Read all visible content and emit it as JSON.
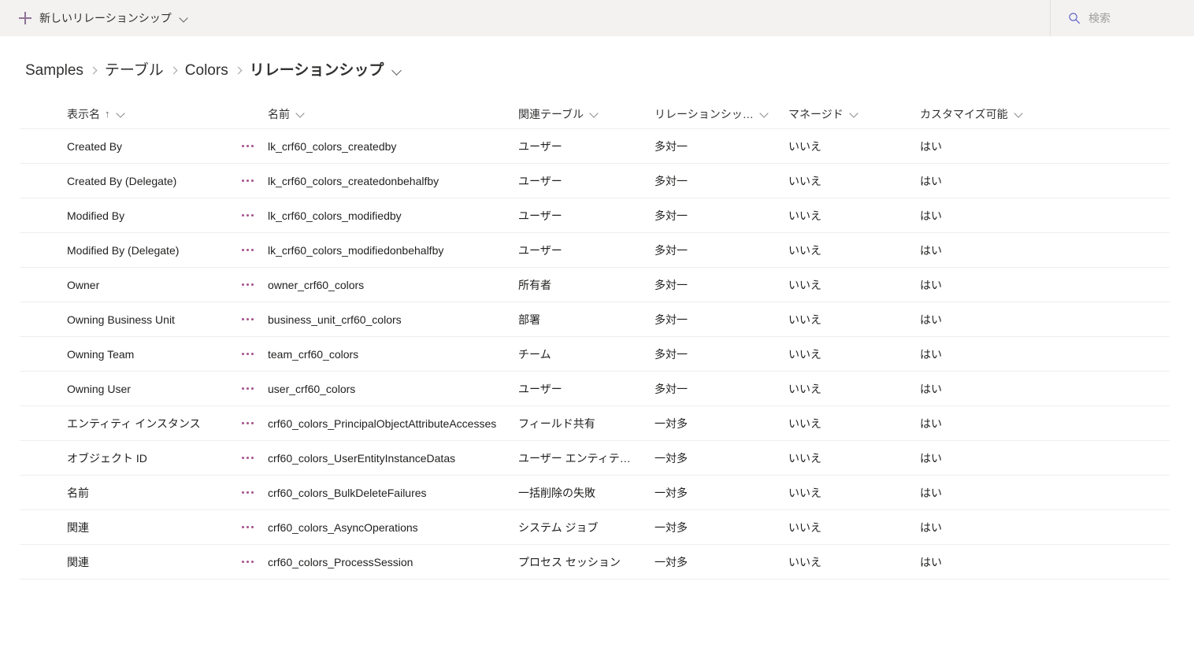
{
  "commandbar": {
    "new_relationship_label": "新しいリレーションシップ",
    "plus_icon": "plus-icon",
    "chevron_icon": "chevron-down-icon",
    "accent_color": "#8f7296"
  },
  "search": {
    "placeholder": "検索",
    "value": "",
    "icon": "search-icon",
    "icon_color": "#5b5fc7"
  },
  "breadcrumb": {
    "items": [
      {
        "label": "Samples",
        "current": false
      },
      {
        "label": "テーブル",
        "current": false
      },
      {
        "label": "Colors",
        "current": false
      },
      {
        "label": "リレーションシップ",
        "current": true
      }
    ],
    "chevron_icon": "chevron-down-icon"
  },
  "grid": {
    "columns": [
      {
        "label": "表示名",
        "sorted": "asc",
        "sort_glyph": "↑"
      },
      {
        "label": "名前",
        "sorted": "none",
        "sort_glyph": ""
      },
      {
        "label": "関連テーブル",
        "sorted": "none",
        "sort_glyph": ""
      },
      {
        "label": "リレーションシッ…",
        "sorted": "none",
        "sort_glyph": ""
      },
      {
        "label": "マネージド",
        "sorted": "none",
        "sort_glyph": ""
      },
      {
        "label": "カスタマイズ可能",
        "sorted": "none",
        "sort_glyph": ""
      }
    ],
    "row_menu_icon": "ellipsis-icon",
    "row_menu_color": "#a4508b",
    "rows": [
      {
        "display_name": "Created By",
        "name": "lk_crf60_colors_createdby",
        "related_table": "ユーザー",
        "relationship_type": "多対一",
        "managed": "いいえ",
        "customizable": "はい"
      },
      {
        "display_name": "Created By (Delegate)",
        "name": "lk_crf60_colors_createdonbehalfby",
        "related_table": "ユーザー",
        "relationship_type": "多対一",
        "managed": "いいえ",
        "customizable": "はい"
      },
      {
        "display_name": "Modified By",
        "name": "lk_crf60_colors_modifiedby",
        "related_table": "ユーザー",
        "relationship_type": "多対一",
        "managed": "いいえ",
        "customizable": "はい"
      },
      {
        "display_name": "Modified By (Delegate)",
        "name": "lk_crf60_colors_modifiedonbehalfby",
        "related_table": "ユーザー",
        "relationship_type": "多対一",
        "managed": "いいえ",
        "customizable": "はい"
      },
      {
        "display_name": "Owner",
        "name": "owner_crf60_colors",
        "related_table": "所有者",
        "relationship_type": "多対一",
        "managed": "いいえ",
        "customizable": "はい"
      },
      {
        "display_name": "Owning Business Unit",
        "name": "business_unit_crf60_colors",
        "related_table": "部署",
        "relationship_type": "多対一",
        "managed": "いいえ",
        "customizable": "はい"
      },
      {
        "display_name": "Owning Team",
        "name": "team_crf60_colors",
        "related_table": "チーム",
        "relationship_type": "多対一",
        "managed": "いいえ",
        "customizable": "はい"
      },
      {
        "display_name": "Owning User",
        "name": "user_crf60_colors",
        "related_table": "ユーザー",
        "relationship_type": "多対一",
        "managed": "いいえ",
        "customizable": "はい"
      },
      {
        "display_name": "エンティティ インスタンス",
        "name": "crf60_colors_PrincipalObjectAttributeAccesses",
        "related_table": "フィールド共有",
        "relationship_type": "一対多",
        "managed": "いいえ",
        "customizable": "はい"
      },
      {
        "display_name": "オブジェクト ID",
        "name": "crf60_colors_UserEntityInstanceDatas",
        "related_table": "ユーザー エンティテ…",
        "relationship_type": "一対多",
        "managed": "いいえ",
        "customizable": "はい"
      },
      {
        "display_name": "名前",
        "name": "crf60_colors_BulkDeleteFailures",
        "related_table": "一括削除の失敗",
        "relationship_type": "一対多",
        "managed": "いいえ",
        "customizable": "はい"
      },
      {
        "display_name": "関連",
        "name": "crf60_colors_AsyncOperations",
        "related_table": "システム ジョブ",
        "relationship_type": "一対多",
        "managed": "いいえ",
        "customizable": "はい"
      },
      {
        "display_name": "関連",
        "name": "crf60_colors_ProcessSession",
        "related_table": "プロセス セッション",
        "relationship_type": "一対多",
        "managed": "いいえ",
        "customizable": "はい"
      }
    ]
  }
}
